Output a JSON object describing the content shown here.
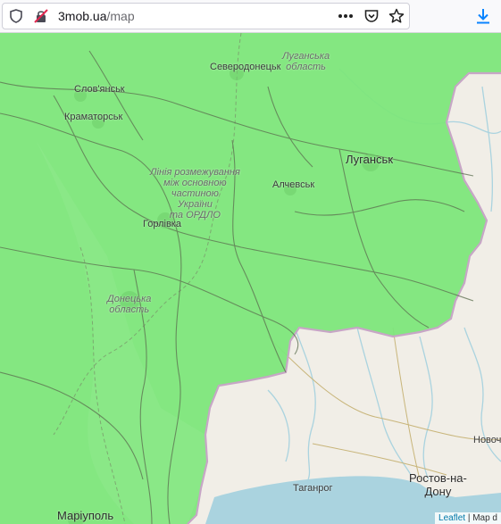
{
  "browser": {
    "url_host": "3mob.ua",
    "url_path": "/map",
    "icons": [
      "shield-icon",
      "insecure-lock-icon",
      "more-icon",
      "pocket-icon",
      "bookmark-star-icon",
      "download-icon"
    ]
  },
  "map": {
    "colors": {
      "coverage": "#7de67b",
      "land": "#f1eee7",
      "water": "#aad3df",
      "border": "#c7a6c6",
      "road": "#5b6e4f"
    },
    "labels": {
      "severodonetsk": "Северодонецьк",
      "luhansk_oblast": "Луганська\nобласть",
      "sloviansk": "Слов'янськ",
      "kramatorsk": "Краматорськ",
      "luhansk": "Луганськ",
      "contact_line": "Лінія розмежування\nміж основною\nчастиною\nУкраїни\nта ОРДЛО",
      "alchevsk": "Алчевськ",
      "horlivka": "Горлівка",
      "donetsk_oblast": "Донецька\nобласть",
      "novoch": "Новоч",
      "taganrog": "Таганрог",
      "rostov": "Ростов-на-\nДону",
      "mariupol": "Маріуполь"
    },
    "attribution": {
      "leaflet": "Leaflet",
      "rest": " | Map d"
    }
  }
}
